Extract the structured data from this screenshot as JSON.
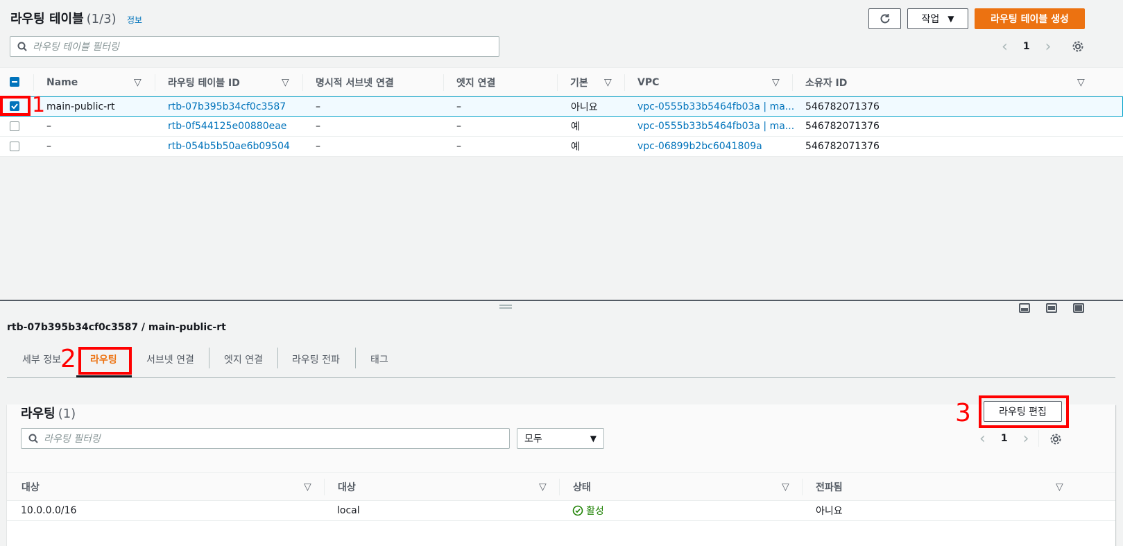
{
  "top": {
    "title": "라우팅 테이블",
    "count": "(1/3)",
    "info": "정보",
    "actions_label": "작업",
    "create_label": "라우팅 테이블 생성",
    "filter_placeholder": "라우팅 테이블 필터링",
    "page": "1",
    "columns": [
      "Name",
      "라우팅 테이블 ID",
      "명시적 서브넷 연결",
      "엣지 연결",
      "기본",
      "VPC",
      "소유자 ID"
    ],
    "rows": [
      {
        "name": "main-public-rt",
        "id": "rtb-07b395b34cf0c3587",
        "subnet": "–",
        "edge": "–",
        "main": "아니요",
        "vpc": "vpc-0555b33b5464fb03a | ma...",
        "owner": "546782071376",
        "selected": true
      },
      {
        "name": "–",
        "id": "rtb-0f544125e00880eae",
        "subnet": "–",
        "edge": "–",
        "main": "예",
        "vpc": "vpc-0555b33b5464fb03a | ma...",
        "owner": "546782071376",
        "selected": false
      },
      {
        "name": "–",
        "id": "rtb-054b5b50ae6b09504",
        "subnet": "–",
        "edge": "–",
        "main": "예",
        "vpc": "vpc-06899b2bc6041809a",
        "owner": "546782071376",
        "selected": false
      }
    ]
  },
  "annotations": {
    "one": "1",
    "two": "2",
    "three": "3"
  },
  "detail": {
    "title": "rtb-07b395b34cf0c3587 / main-public-rt",
    "tabs": [
      "세부 정보",
      "라우팅",
      "서브넷 연결",
      "엣지 연결",
      "라우팅 전파",
      "태그"
    ],
    "active_tab": "라우팅",
    "panel_title": "라우팅",
    "panel_count": "(1)",
    "edit_label": "라우팅 편집",
    "filter_placeholder": "라우팅 필터링",
    "filter_select": "모두",
    "page": "1",
    "columns": [
      "대상",
      "대상",
      "상태",
      "전파됨"
    ],
    "rows": [
      {
        "destination": "10.0.0.0/16",
        "target": "local",
        "status": "활성",
        "propagated": "아니요"
      }
    ]
  },
  "colors": {
    "accent": "#ec7211",
    "link": "#0073bb",
    "annotation": "#ff0000",
    "active_status": "#1d8102"
  }
}
